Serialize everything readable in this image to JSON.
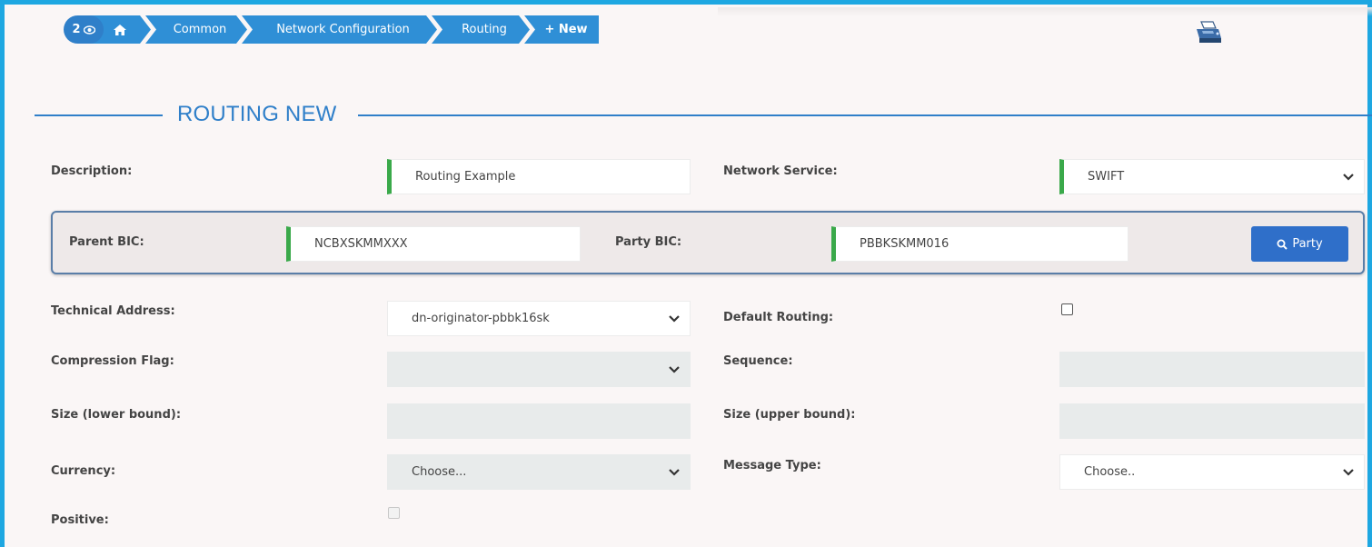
{
  "breadcrumb": {
    "count": "2",
    "items": [
      "Common",
      "Network Configuration",
      "Routing",
      "+ New"
    ]
  },
  "section": {
    "title": "ROUTING NEW"
  },
  "form": {
    "description": {
      "label": "Description:",
      "value": "Routing Example"
    },
    "network_service": {
      "label": "Network Service:",
      "value": "SWIFT"
    },
    "parent_bic": {
      "label": "Parent BIC:",
      "value": "NCBXSKMMXXX"
    },
    "party_bic": {
      "label": "Party BIC:",
      "value": "PBBKSKMM016"
    },
    "party_button": {
      "label": "Party"
    },
    "technical_address": {
      "label": "Technical Address:",
      "value": "dn-originator-pbbk16sk"
    },
    "default_routing": {
      "label": "Default Routing:",
      "checked": false
    },
    "compression_flag": {
      "label": "Compression Flag:",
      "value": ""
    },
    "sequence": {
      "label": "Sequence:",
      "value": ""
    },
    "size_lower": {
      "label": "Size (lower bound):",
      "value": ""
    },
    "size_upper": {
      "label": "Size (upper bound):",
      "value": ""
    },
    "currency": {
      "label": "Currency:",
      "value": "Choose..."
    },
    "message_type": {
      "label": "Message Type:",
      "value": "Choose.."
    },
    "positive": {
      "label": "Positive:",
      "checked": false
    }
  },
  "colors": {
    "accent": "#2f7fc9",
    "breadcrumb": "#2f8fd6",
    "required": "#3aa94a",
    "frame": "#1ea7e1"
  },
  "icons": [
    "eye-icon",
    "home-icon",
    "printer-icon",
    "chevron-down-icon",
    "search-icon"
  ]
}
